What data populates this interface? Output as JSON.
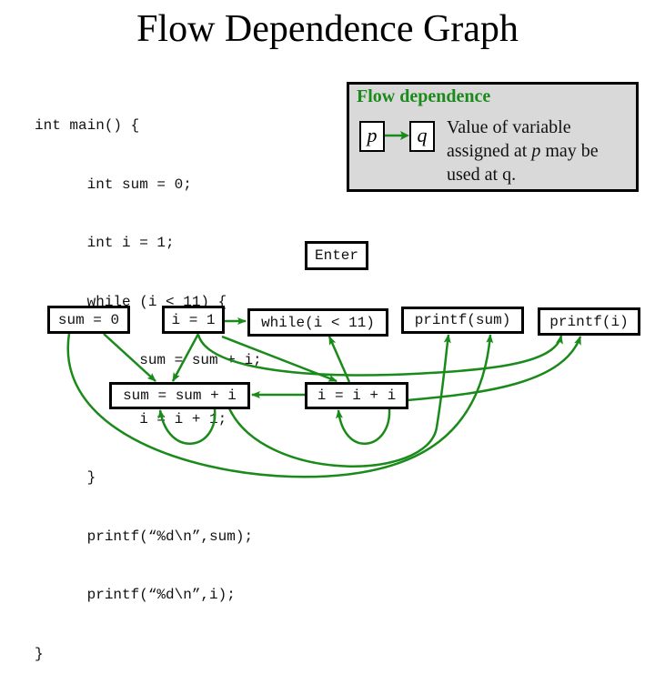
{
  "title": "Flow Dependence Graph",
  "code": {
    "lines": [
      "int main() {",
      "      int sum = 0;",
      "      int i = 1;",
      "      while (i < 11) {",
      "            sum = sum + i;",
      "            i = i + 1;",
      "      }",
      "      printf(“%d\\n”,sum);",
      "      printf(“%d\\n”,i);",
      "}"
    ]
  },
  "legend": {
    "title": "Flow dependence",
    "p_label": "p",
    "q_label": "q",
    "desc_line1": "Value of variable",
    "desc_line2_pre": "assigned at ",
    "desc_line2_var": "p",
    "desc_line2_post": " may be",
    "desc_line3": "used at q.",
    "accent_color": "#1a8a1a"
  },
  "graph": {
    "edge_color": "#1a8a1a",
    "nodes": {
      "enter": "Enter",
      "sum0": "sum = 0",
      "i1": "i = 1",
      "while": "while(i < 11)",
      "printf_sum": "printf(sum)",
      "printf_i": "printf(i)",
      "sum_update": "sum = sum + i",
      "i_update": "i = i + i"
    },
    "edges": [
      {
        "from": "i1",
        "to": "while"
      },
      {
        "from": "sum0",
        "to": "sum_update"
      },
      {
        "from": "i1",
        "to": "sum_update"
      },
      {
        "from": "i1",
        "to": "i_update"
      },
      {
        "from": "i1",
        "to": "printf_i"
      },
      {
        "from": "i_update",
        "to": "while"
      },
      {
        "from": "i_update",
        "to": "sum_update"
      },
      {
        "from": "i_update",
        "to": "printf_i"
      },
      {
        "from": "sum_update",
        "to": "sum_update"
      },
      {
        "from": "i_update",
        "to": "i_update"
      },
      {
        "from": "sum_update",
        "to": "printf_sum"
      },
      {
        "from": "sum0",
        "to": "printf_sum"
      }
    ]
  }
}
